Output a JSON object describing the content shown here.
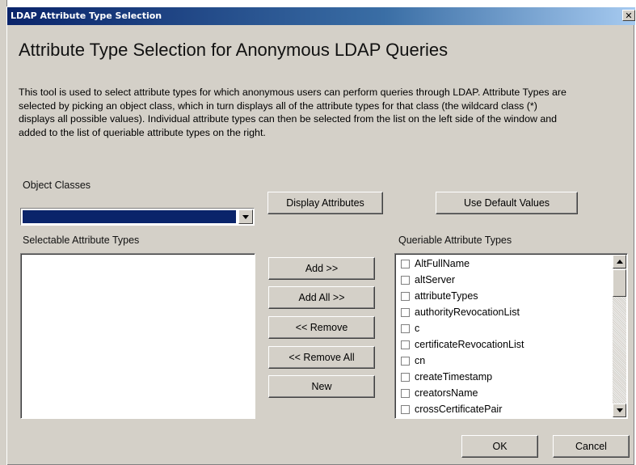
{
  "window": {
    "title": "LDAP Attribute Type Selection",
    "close_glyph": "✕"
  },
  "heading": "Attribute Type Selection for Anonymous LDAP Queries",
  "description": "This tool is used to select attribute types for which anonymous users can perform queries through LDAP.  Attribute Types are selected by picking an object class, which in turn displays all of the attribute types for that class (the wildcard class (*) displays all possible values).  Individual attribute types can then be selected from the list on the left side of the window and added to the list of queriable attribute types on the right.",
  "object_classes": {
    "label": "Object Classes",
    "selected_value": ""
  },
  "buttons": {
    "display_attributes": "Display Attributes",
    "use_default_values": "Use Default Values",
    "add": "Add >>",
    "add_all": "Add All >>",
    "remove": "<< Remove",
    "remove_all": "<< Remove All",
    "new": "New",
    "ok": "OK",
    "cancel": "Cancel"
  },
  "selectable": {
    "label": "Selectable Attribute Types",
    "items": []
  },
  "queriable": {
    "label": "Queriable Attribute Types",
    "items": [
      {
        "label": "AltFullName",
        "checked": false
      },
      {
        "label": "altServer",
        "checked": false
      },
      {
        "label": "attributeTypes",
        "checked": false
      },
      {
        "label": "authorityRevocationList",
        "checked": false
      },
      {
        "label": "c",
        "checked": false
      },
      {
        "label": "certificateRevocationList",
        "checked": false
      },
      {
        "label": "cn",
        "checked": false
      },
      {
        "label": "createTimestamp",
        "checked": false
      },
      {
        "label": "creatorsName",
        "checked": false
      },
      {
        "label": "crossCertificatePair",
        "checked": false
      }
    ]
  },
  "colors": {
    "title_bar": "#0a246a",
    "dialog_face": "#d4d0c8",
    "combo_selection": "#0a246a"
  }
}
